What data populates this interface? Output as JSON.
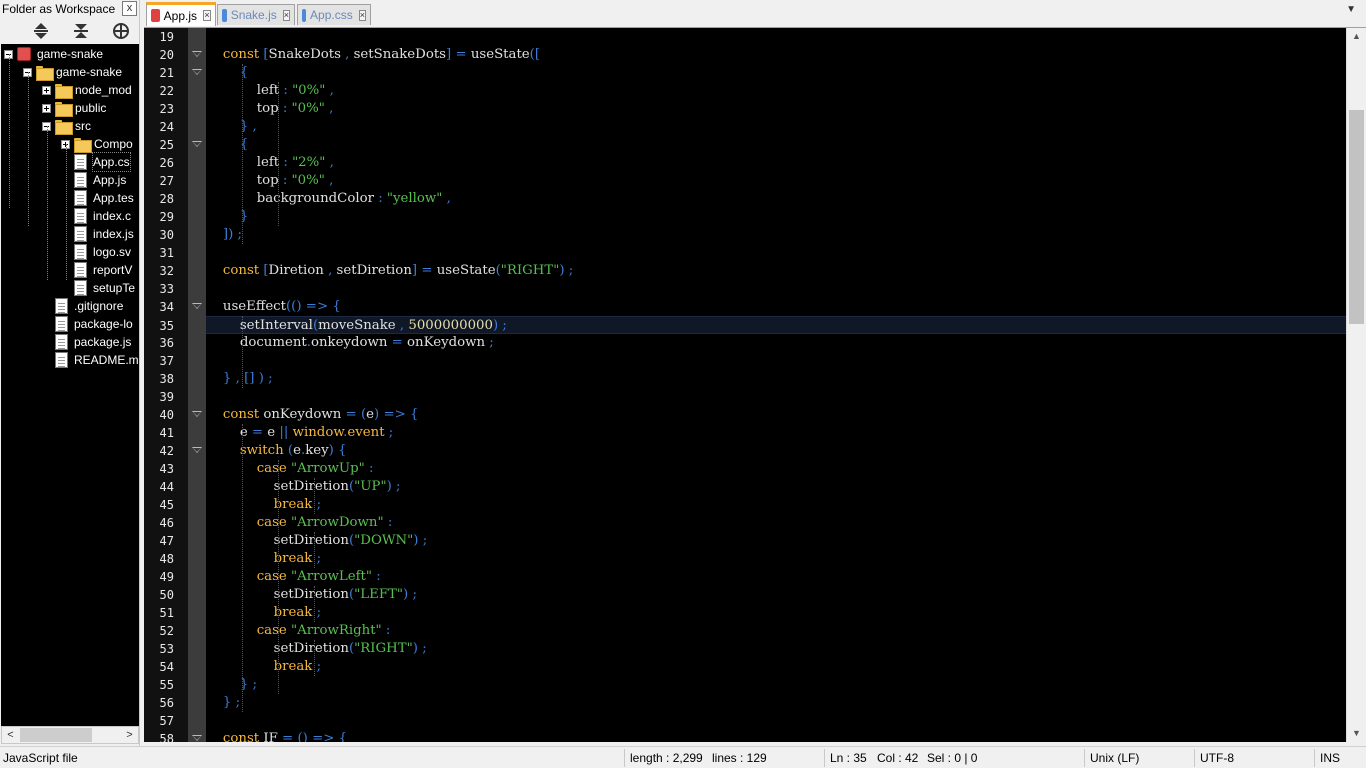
{
  "panel": {
    "title": "Folder as Workspace",
    "close_glyph": "x",
    "tree": [
      {
        "label": "game-snake",
        "level": 0,
        "type": "project",
        "expander": "minus"
      },
      {
        "label": "game-snake",
        "level": 1,
        "type": "folder",
        "expander": "minus"
      },
      {
        "label": "node_mod",
        "level": 2,
        "type": "folder",
        "expander": "plus"
      },
      {
        "label": "public",
        "level": 2,
        "type": "folder",
        "expander": "plus"
      },
      {
        "label": "src",
        "level": 2,
        "type": "folder",
        "expander": "minus"
      },
      {
        "label": "Compo",
        "level": 3,
        "type": "folder",
        "expander": "plus"
      },
      {
        "label": "App.cs",
        "level": 3,
        "type": "file",
        "selected": true
      },
      {
        "label": "App.js",
        "level": 3,
        "type": "file"
      },
      {
        "label": "App.tes",
        "level": 3,
        "type": "file"
      },
      {
        "label": "index.c",
        "level": 3,
        "type": "file"
      },
      {
        "label": "index.js",
        "level": 3,
        "type": "file"
      },
      {
        "label": "logo.sv",
        "level": 3,
        "type": "file"
      },
      {
        "label": "reportV",
        "level": 3,
        "type": "file"
      },
      {
        "label": "setupTe",
        "level": 3,
        "type": "file"
      },
      {
        "label": ".gitignore",
        "level": 2,
        "type": "file"
      },
      {
        "label": "package-lo",
        "level": 2,
        "type": "file"
      },
      {
        "label": "package.js",
        "level": 2,
        "type": "file"
      },
      {
        "label": "README.m",
        "level": 2,
        "type": "file"
      }
    ]
  },
  "tabs": [
    {
      "label": "App.js",
      "active": true,
      "icon_color": "#e04040"
    },
    {
      "label": "Snake.js",
      "active": false,
      "icon_color": "#4a8ad8"
    },
    {
      "label": "App.css",
      "active": false,
      "icon_color": "#4a8ad8"
    }
  ],
  "editor": {
    "current_line": 35,
    "lines": [
      {
        "n": "19",
        "fold": false,
        "text": ""
      },
      {
        "n": "20",
        "fold": true,
        "text": "    <k>const</k> <o>[</o>SnakeDots <o>,</o> setSnakeDots<o>]</o> <o>=</o> useState<o>([</o>"
      },
      {
        "n": "21",
        "fold": true,
        "text": "        <o>{</o>"
      },
      {
        "n": "22",
        "fold": false,
        "text": "            left <o>:</o> <s>\"0%\"</s> <o>,</o>"
      },
      {
        "n": "23",
        "fold": false,
        "text": "            top <o>:</o> <s>\"0%\"</s> <o>,</o>"
      },
      {
        "n": "24",
        "fold": false,
        "text": "        <o>}</o> <o>,</o>"
      },
      {
        "n": "25",
        "fold": true,
        "text": "        <o>{</o>"
      },
      {
        "n": "26",
        "fold": false,
        "text": "            left <o>:</o> <s>\"2%\"</s> <o>,</o>"
      },
      {
        "n": "27",
        "fold": false,
        "text": "            top <o>:</o> <s>\"0%\"</s> <o>,</o>"
      },
      {
        "n": "28",
        "fold": false,
        "text": "            backgroundColor <o>:</o> <s>\"yellow\"</s> <o>,</o>"
      },
      {
        "n": "29",
        "fold": false,
        "text": "        <o>}</o>"
      },
      {
        "n": "30",
        "fold": false,
        "text": "    <o>])</o> <o>;</o>"
      },
      {
        "n": "31",
        "fold": false,
        "text": ""
      },
      {
        "n": "32",
        "fold": false,
        "text": "    <k>const</k> <o>[</o>Diretion <o>,</o> setDiretion<o>]</o> <o>=</o> useState<o>(</o><s>\"RIGHT\"</s><o>)</o> <o>;</o>"
      },
      {
        "n": "33",
        "fold": false,
        "text": ""
      },
      {
        "n": "34",
        "fold": true,
        "text": "    useEffect<o>(()</o> <o>=></o> <o>{</o>"
      },
      {
        "n": "35",
        "fold": false,
        "text": "        setInterval<o>(</o>moveSnake <o>,</o> <n>5000000000</n><o>)</o> <o>;</o>"
      },
      {
        "n": "36",
        "fold": false,
        "text": "        document<o>.</o>onkeydown <o>=</o> onKeydown <o>;</o>"
      },
      {
        "n": "37",
        "fold": false,
        "text": ""
      },
      {
        "n": "38",
        "fold": false,
        "text": "    <o>}</o> <o>,</o> <o>[]</o> <o>)</o> <o>;</o>"
      },
      {
        "n": "39",
        "fold": false,
        "text": ""
      },
      {
        "n": "40",
        "fold": true,
        "text": "    <k>const</k> onKeydown <o>=</o> <o>(</o>e<o>)</o> <o>=></o> <o>{</o>"
      },
      {
        "n": "41",
        "fold": false,
        "text": "        e <o>=</o> e <o>||</o> <k>window</k><o>.</o><k>event</k> <o>;</o>"
      },
      {
        "n": "42",
        "fold": true,
        "text": "        <k>switch</k> <o>(</o>e<o>.</o>key<o>)</o> <o>{</o>"
      },
      {
        "n": "43",
        "fold": false,
        "text": "            <k>case</k> <s>\"ArrowUp\"</s> <o>:</o>"
      },
      {
        "n": "44",
        "fold": false,
        "text": "                setDiretion<o>(</o><s>\"UP\"</s><o>)</o> <o>;</o>"
      },
      {
        "n": "45",
        "fold": false,
        "text": "                <k>break</k> <o>;</o>"
      },
      {
        "n": "46",
        "fold": false,
        "text": "            <k>case</k> <s>\"ArrowDown\"</s> <o>:</o>"
      },
      {
        "n": "47",
        "fold": false,
        "text": "                setDiretion<o>(</o><s>\"DOWN\"</s><o>)</o> <o>;</o>"
      },
      {
        "n": "48",
        "fold": false,
        "text": "                <k>break</k> <o>;</o>"
      },
      {
        "n": "49",
        "fold": false,
        "text": "            <k>case</k> <s>\"ArrowLeft\"</s> <o>:</o>"
      },
      {
        "n": "50",
        "fold": false,
        "text": "                setDiretion<o>(</o><s>\"LEFT\"</s><o>)</o> <o>;</o>"
      },
      {
        "n": "51",
        "fold": false,
        "text": "                <k>break</k> <o>;</o>"
      },
      {
        "n": "52",
        "fold": false,
        "text": "            <k>case</k> <s>\"ArrowRight\"</s> <o>:</o>"
      },
      {
        "n": "53",
        "fold": false,
        "text": "                setDiretion<o>(</o><s>\"RIGHT\"</s><o>)</o> <o>;</o>"
      },
      {
        "n": "54",
        "fold": false,
        "text": "                <k>break</k> <o>;</o>"
      },
      {
        "n": "55",
        "fold": false,
        "text": "        <o>}</o> <o>;</o>"
      },
      {
        "n": "56",
        "fold": false,
        "text": "    <o>}</o> <o>;</o>"
      },
      {
        "n": "57",
        "fold": false,
        "text": ""
      },
      {
        "n": "58",
        "fold": true,
        "text": "    <k>const</k> IF <o>=</o> <o>()</o> <o>=></o> <o>{</o>"
      }
    ]
  },
  "status": {
    "file_type": "JavaScript file",
    "length": "length : 2,299",
    "lines": "lines : 129",
    "ln": "Ln : 35",
    "col": "Col : 42",
    "sel": "Sel : 0 | 0",
    "eol": "Unix (LF)",
    "encoding": "UTF-8",
    "mode": "INS"
  },
  "colors": {
    "keyword": "#f5b841",
    "string": "#58c050",
    "operator": "#3c7dd6",
    "number": "#e6e0a8",
    "editor_bg": "#000000",
    "tab_accent": "#f5a623"
  },
  "icons": {
    "expand_all": "collapse-up-down-icon",
    "collapse_all": "collapse-arrows-icon",
    "locate": "crosshair-icon"
  },
  "scroll": {
    "left_glyph": "<",
    "right_glyph": ">",
    "up_glyph": "▲",
    "down_glyph": "▼",
    "tab_right_glyph": "▼"
  }
}
